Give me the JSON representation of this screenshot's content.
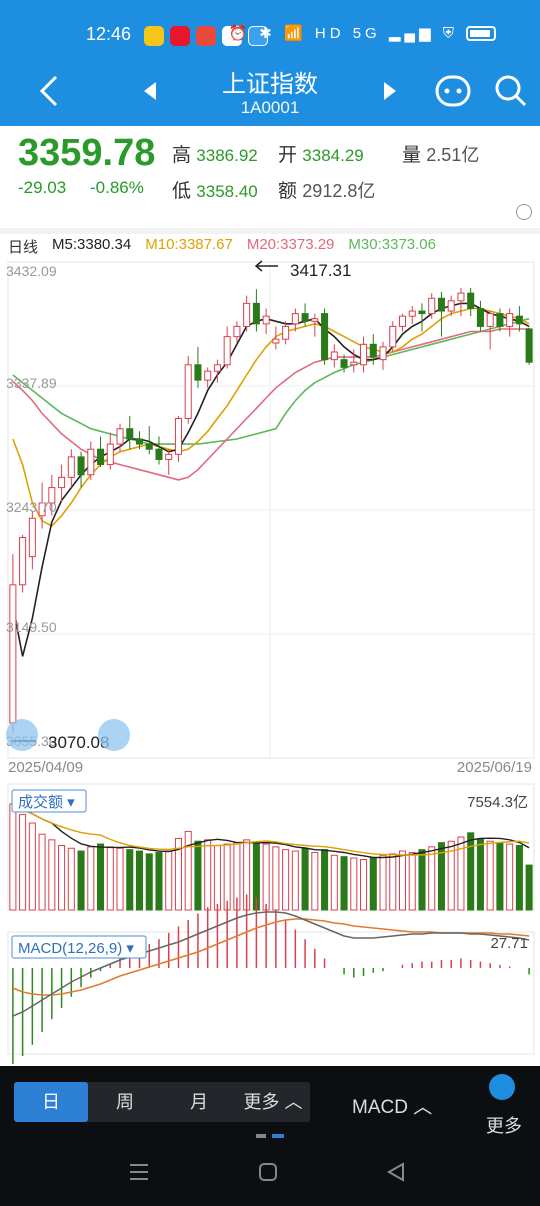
{
  "status": {
    "time": "12:46",
    "icons": "⏰ ✱ 📶 HD 5G ▂▄▆ ⛨"
  },
  "header": {
    "title": "上证指数",
    "code": "1A0001"
  },
  "quote": {
    "price": "3359.78",
    "change": "-29.03",
    "change_pct": "-0.86%",
    "high_label": "高",
    "high": "3386.92",
    "open_label": "开",
    "open": "3384.29",
    "vol_label": "量",
    "vol": "2.51亿",
    "low_label": "低",
    "low": "3358.40",
    "amount_label": "额",
    "amount": "2912.8亿"
  },
  "ma": {
    "period": "日线",
    "m5": "M5:3380.34",
    "m10": "M10:3387.67",
    "m20": "M20:3373.29",
    "m30": "M30:3373.06",
    "colors": {
      "m5": "#222222",
      "m10": "#e0a000",
      "m20": "#e06a80",
      "m30": "#5cb85c"
    }
  },
  "chart_data": {
    "type": "candlestick",
    "price_axis": [
      "3432.09",
      "3337.89",
      "3243.70",
      "3149.50",
      "3055.30"
    ],
    "ylim": [
      3055.3,
      3432.09
    ],
    "max_label": "3417.31",
    "min_label": "3070.08",
    "date_start": "2025/04/09",
    "date_end": "2025/06/19",
    "candles": [
      [
        3078,
        3210,
        3070,
        3186
      ],
      [
        3186,
        3225,
        3180,
        3223
      ],
      [
        3208,
        3243,
        3198,
        3238
      ],
      [
        3240,
        3266,
        3230,
        3250
      ],
      [
        3250,
        3272,
        3240,
        3262
      ],
      [
        3262,
        3280,
        3250,
        3270
      ],
      [
        3270,
        3292,
        3262,
        3286
      ],
      [
        3286,
        3290,
        3262,
        3272
      ],
      [
        3272,
        3298,
        3268,
        3292
      ],
      [
        3292,
        3302,
        3278,
        3280
      ],
      [
        3280,
        3305,
        3276,
        3296
      ],
      [
        3296,
        3312,
        3290,
        3308
      ],
      [
        3308,
        3318,
        3292,
        3300
      ],
      [
        3300,
        3306,
        3292,
        3296
      ],
      [
        3296,
        3310,
        3288,
        3292
      ],
      [
        3292,
        3302,
        3280,
        3284
      ],
      [
        3284,
        3292,
        3272,
        3288
      ],
      [
        3288,
        3318,
        3282,
        3316
      ],
      [
        3316,
        3365,
        3312,
        3358
      ],
      [
        3358,
        3372,
        3340,
        3346
      ],
      [
        3346,
        3356,
        3340,
        3353
      ],
      [
        3353,
        3362,
        3344,
        3358
      ],
      [
        3358,
        3388,
        3355,
        3380
      ],
      [
        3380,
        3392,
        3376,
        3388
      ],
      [
        3388,
        3412,
        3384,
        3406
      ],
      [
        3406,
        3417,
        3384,
        3390
      ],
      [
        3390,
        3402,
        3382,
        3396
      ],
      [
        3375,
        3388,
        3370,
        3378
      ],
      [
        3378,
        3392,
        3374,
        3388
      ],
      [
        3390,
        3402,
        3384,
        3398
      ],
      [
        3398,
        3406,
        3388,
        3392
      ],
      [
        3392,
        3398,
        3380,
        3394
      ],
      [
        3398,
        3402,
        3358,
        3362
      ],
      [
        3362,
        3374,
        3356,
        3368
      ],
      [
        3362,
        3366,
        3352,
        3356
      ],
      [
        3358,
        3370,
        3352,
        3360
      ],
      [
        3358,
        3380,
        3352,
        3374
      ],
      [
        3374,
        3382,
        3358,
        3364
      ],
      [
        3362,
        3376,
        3354,
        3372
      ],
      [
        3372,
        3392,
        3368,
        3388
      ],
      [
        3388,
        3398,
        3384,
        3396
      ],
      [
        3396,
        3404,
        3390,
        3400
      ],
      [
        3400,
        3406,
        3384,
        3398
      ],
      [
        3398,
        3414,
        3394,
        3410
      ],
      [
        3410,
        3415,
        3380,
        3400
      ],
      [
        3400,
        3412,
        3396,
        3408
      ],
      [
        3408,
        3418,
        3396,
        3414
      ],
      [
        3414,
        3418,
        3396,
        3402
      ],
      [
        3402,
        3408,
        3384,
        3388
      ],
      [
        3388,
        3400,
        3370,
        3398
      ],
      [
        3398,
        3402,
        3384,
        3388
      ],
      [
        3388,
        3402,
        3380,
        3398
      ],
      [
        3396,
        3404,
        3384,
        3390
      ],
      [
        3386,
        3387,
        3358,
        3360
      ]
    ],
    "ma5": [
      3170,
      3130,
      3160,
      3200,
      3235,
      3252,
      3262,
      3272,
      3280,
      3286,
      3290,
      3294,
      3300,
      3300,
      3298,
      3294,
      3290,
      3292,
      3305,
      3320,
      3338,
      3350,
      3360,
      3374,
      3388,
      3392,
      3394,
      3392,
      3390,
      3390,
      3392,
      3394,
      3386,
      3380,
      3372,
      3366,
      3362,
      3362,
      3364,
      3372,
      3382,
      3388,
      3392,
      3398,
      3402,
      3404,
      3406,
      3406,
      3402,
      3398,
      3396,
      3394,
      3392,
      3388
    ],
    "ma10": [
      3300,
      3280,
      3250,
      3236,
      3232,
      3240,
      3250,
      3262,
      3272,
      3280,
      3286,
      3290,
      3292,
      3294,
      3296,
      3294,
      3292,
      3290,
      3292,
      3298,
      3306,
      3316,
      3326,
      3338,
      3350,
      3362,
      3372,
      3380,
      3384,
      3386,
      3388,
      3390,
      3388,
      3384,
      3380,
      3376,
      3372,
      3370,
      3368,
      3368,
      3372,
      3378,
      3382,
      3388,
      3394,
      3398,
      3400,
      3402,
      3402,
      3400,
      3398,
      3396,
      3394,
      3390
    ],
    "ma20": [
      3345,
      3338,
      3330,
      3320,
      3312,
      3304,
      3298,
      3292,
      3288,
      3284,
      3282,
      3280,
      3278,
      3276,
      3274,
      3272,
      3270,
      3268,
      3270,
      3276,
      3284,
      3292,
      3300,
      3308,
      3316,
      3324,
      3332,
      3340,
      3346,
      3352,
      3356,
      3360,
      3362,
      3364,
      3364,
      3364,
      3364,
      3364,
      3366,
      3368,
      3370,
      3372,
      3374,
      3376,
      3378,
      3380,
      3382,
      3384,
      3384,
      3384,
      3386,
      3386,
      3386,
      3386
    ],
    "ma30": [
      3350,
      3344,
      3338,
      3332,
      3326,
      3320,
      3316,
      3312,
      3308,
      3306,
      3304,
      3302,
      3300,
      3298,
      3296,
      3296,
      3296,
      3296,
      3296,
      3296,
      3297,
      3298,
      3299,
      3300,
      3302,
      3304,
      3306,
      3308,
      3320,
      3330,
      3338,
      3344,
      3348,
      3352,
      3355,
      3358,
      3360,
      3362,
      3364,
      3366,
      3368,
      3370,
      3372,
      3374,
      3376,
      3378,
      3380,
      3382,
      3384,
      3386,
      3388,
      3390,
      3392,
      3394
    ],
    "volume_label": "成交额",
    "volume_max": "7554.3亿",
    "volume": [
      7554,
      6800,
      6200,
      5400,
      5000,
      4600,
      4400,
      4200,
      4500,
      4700,
      4500,
      4400,
      4300,
      4200,
      4000,
      4100,
      4200,
      5100,
      5600,
      4900,
      5000,
      4600,
      4700,
      4800,
      5000,
      4800,
      4700,
      4500,
      4300,
      4200,
      4400,
      4100,
      4300,
      3900,
      3800,
      3700,
      3600,
      3700,
      3900,
      4000,
      4200,
      4100,
      4300,
      4500,
      4800,
      4900,
      5200,
      5500,
      5100,
      4900,
      4800,
      4700,
      4600,
      3200
    ],
    "macd_label": "MACD(12,26,9)",
    "macd_value": "27.71",
    "macd_hist": [
      -60,
      -55,
      -48,
      -40,
      -32,
      -25,
      -18,
      -12,
      -6,
      -2,
      2,
      6,
      10,
      12,
      15,
      18,
      22,
      26,
      30,
      34,
      38,
      40,
      42,
      44,
      46,
      44,
      40,
      36,
      30,
      24,
      18,
      12,
      6,
      0,
      -4,
      -6,
      -5,
      -3,
      -2,
      0,
      2,
      3,
      4,
      4,
      5,
      5,
      6,
      5,
      4,
      3,
      2,
      1,
      0,
      -4
    ],
    "dif": [
      -48,
      -44,
      -38,
      -32,
      -26,
      -20,
      -14,
      -9,
      -4,
      0,
      4,
      8,
      11,
      14,
      17,
      20,
      23,
      26,
      30,
      34,
      38,
      42,
      46,
      50,
      53,
      55,
      56,
      56,
      55,
      52,
      48,
      44,
      40,
      36,
      32,
      30,
      30,
      30,
      31,
      32,
      33,
      34,
      34,
      35,
      35,
      35,
      35,
      34,
      34,
      33,
      32,
      31,
      30,
      28
    ],
    "dea": [
      -20,
      -24,
      -26,
      -27,
      -27,
      -26,
      -24,
      -22,
      -19,
      -16,
      -12,
      -8,
      -5,
      -2,
      1,
      4,
      7,
      10,
      13,
      16,
      20,
      24,
      28,
      32,
      36,
      40,
      43,
      46,
      48,
      49,
      49,
      48,
      47,
      45,
      44,
      42,
      41,
      40,
      39,
      38,
      37,
      36,
      36,
      36,
      35,
      35,
      35,
      35,
      35,
      35,
      34,
      34,
      33,
      32
    ]
  },
  "periods": [
    "日",
    "周",
    "月",
    "更多 ︿"
  ],
  "indicator": "MACD ︿",
  "more": "更多"
}
